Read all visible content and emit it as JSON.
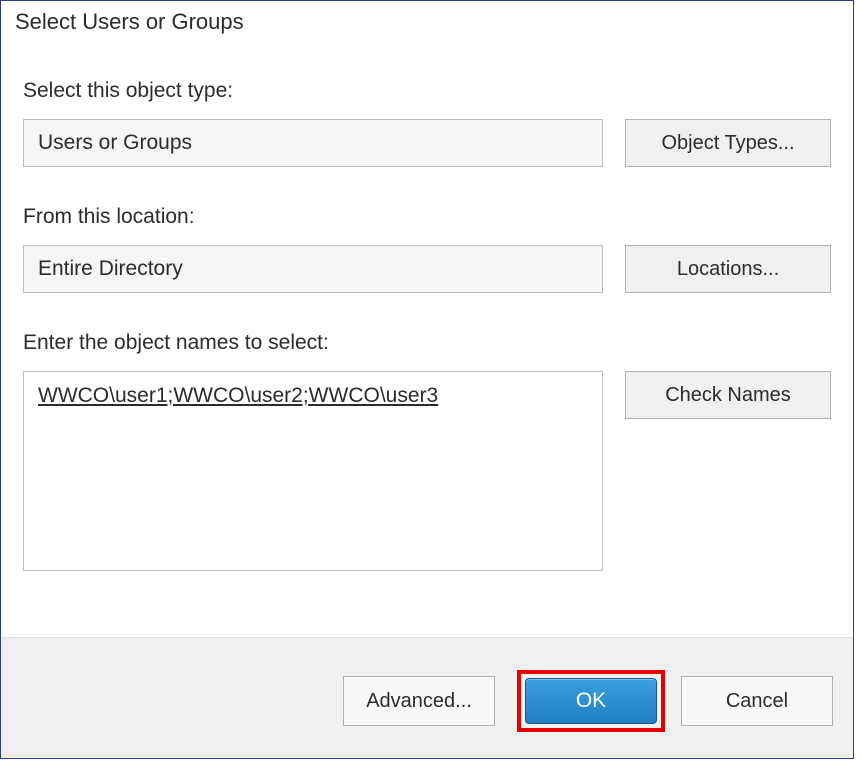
{
  "dialog": {
    "title": "Select Users or Groups",
    "objectType": {
      "label": "Select this object type:",
      "value": "Users or Groups",
      "button": "Object Types..."
    },
    "location": {
      "label": "From this location:",
      "value": "Entire Directory",
      "button": "Locations..."
    },
    "objectNames": {
      "label": "Enter the object names to select:",
      "value": "WWCO\\user1;WWCO\\user2;WWCO\\user3",
      "button": "Check Names"
    },
    "footer": {
      "advanced": "Advanced...",
      "ok": "OK",
      "cancel": "Cancel"
    }
  }
}
